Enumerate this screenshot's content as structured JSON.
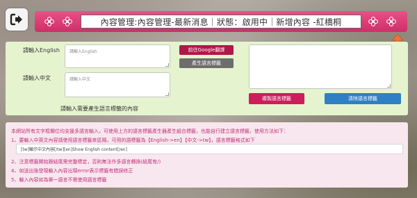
{
  "header": {
    "title": "內容管理:內容管理-最新消息｜狀態：啟用中｜新增內容 -紅橋桐"
  },
  "form": {
    "english_label": "請輸入English",
    "english_placeholder": "請輸入English",
    "chinese_label": "請輸入中文",
    "chinese_placeholder": "請輸入中文",
    "google_translate_button": "前往Google翻譯",
    "generate_tag_button": "產生語言標籤",
    "copy_tag_button": "複製語言標籤",
    "clear_tag_button": "清除語言標籤",
    "tag_prompt": "請輸入需要產生語言標籤的內容"
  },
  "info": {
    "intro": "本網站所有文字框欄位均支援多語言輸入，可使用上方的語言標籤產生器產生組合標籤，也能自行建立語言標籤，使用方法如下：",
    "line1": "1、要輸入中英文內容請使用語言標籤來區隔，可用的語標籤為【English->en】【中文->tw】，語言標籤格式如下",
    "example": "[tw]顯示中文內容[/tw][en]Show English content[/en]",
    "line2": "2、注意標籤開始跟結尾需完整標定，否則無法作多語言轉換(結尾有/)",
    "line4": "4、如送出後發現輸入內容出現error表示標籤有錯誤修正",
    "line5": "5、輸入內容如為單一語言不需使用語言標籤"
  },
  "colors": {
    "title_bar": "#d93a72",
    "form_bg": "#e5f4cf",
    "info_bg": "#f8e7ee",
    "google_btn": "#b0184a",
    "generate_btn": "#6d6d6d",
    "copy_btn": "#cc1d5c",
    "clear_btn": "#2f7fc4",
    "info_text": "#c0307a"
  },
  "icons": [
    "exit-icon",
    "flower-icon",
    "scroll-top-icon",
    "add-icon",
    "resize-handle-icon"
  ]
}
